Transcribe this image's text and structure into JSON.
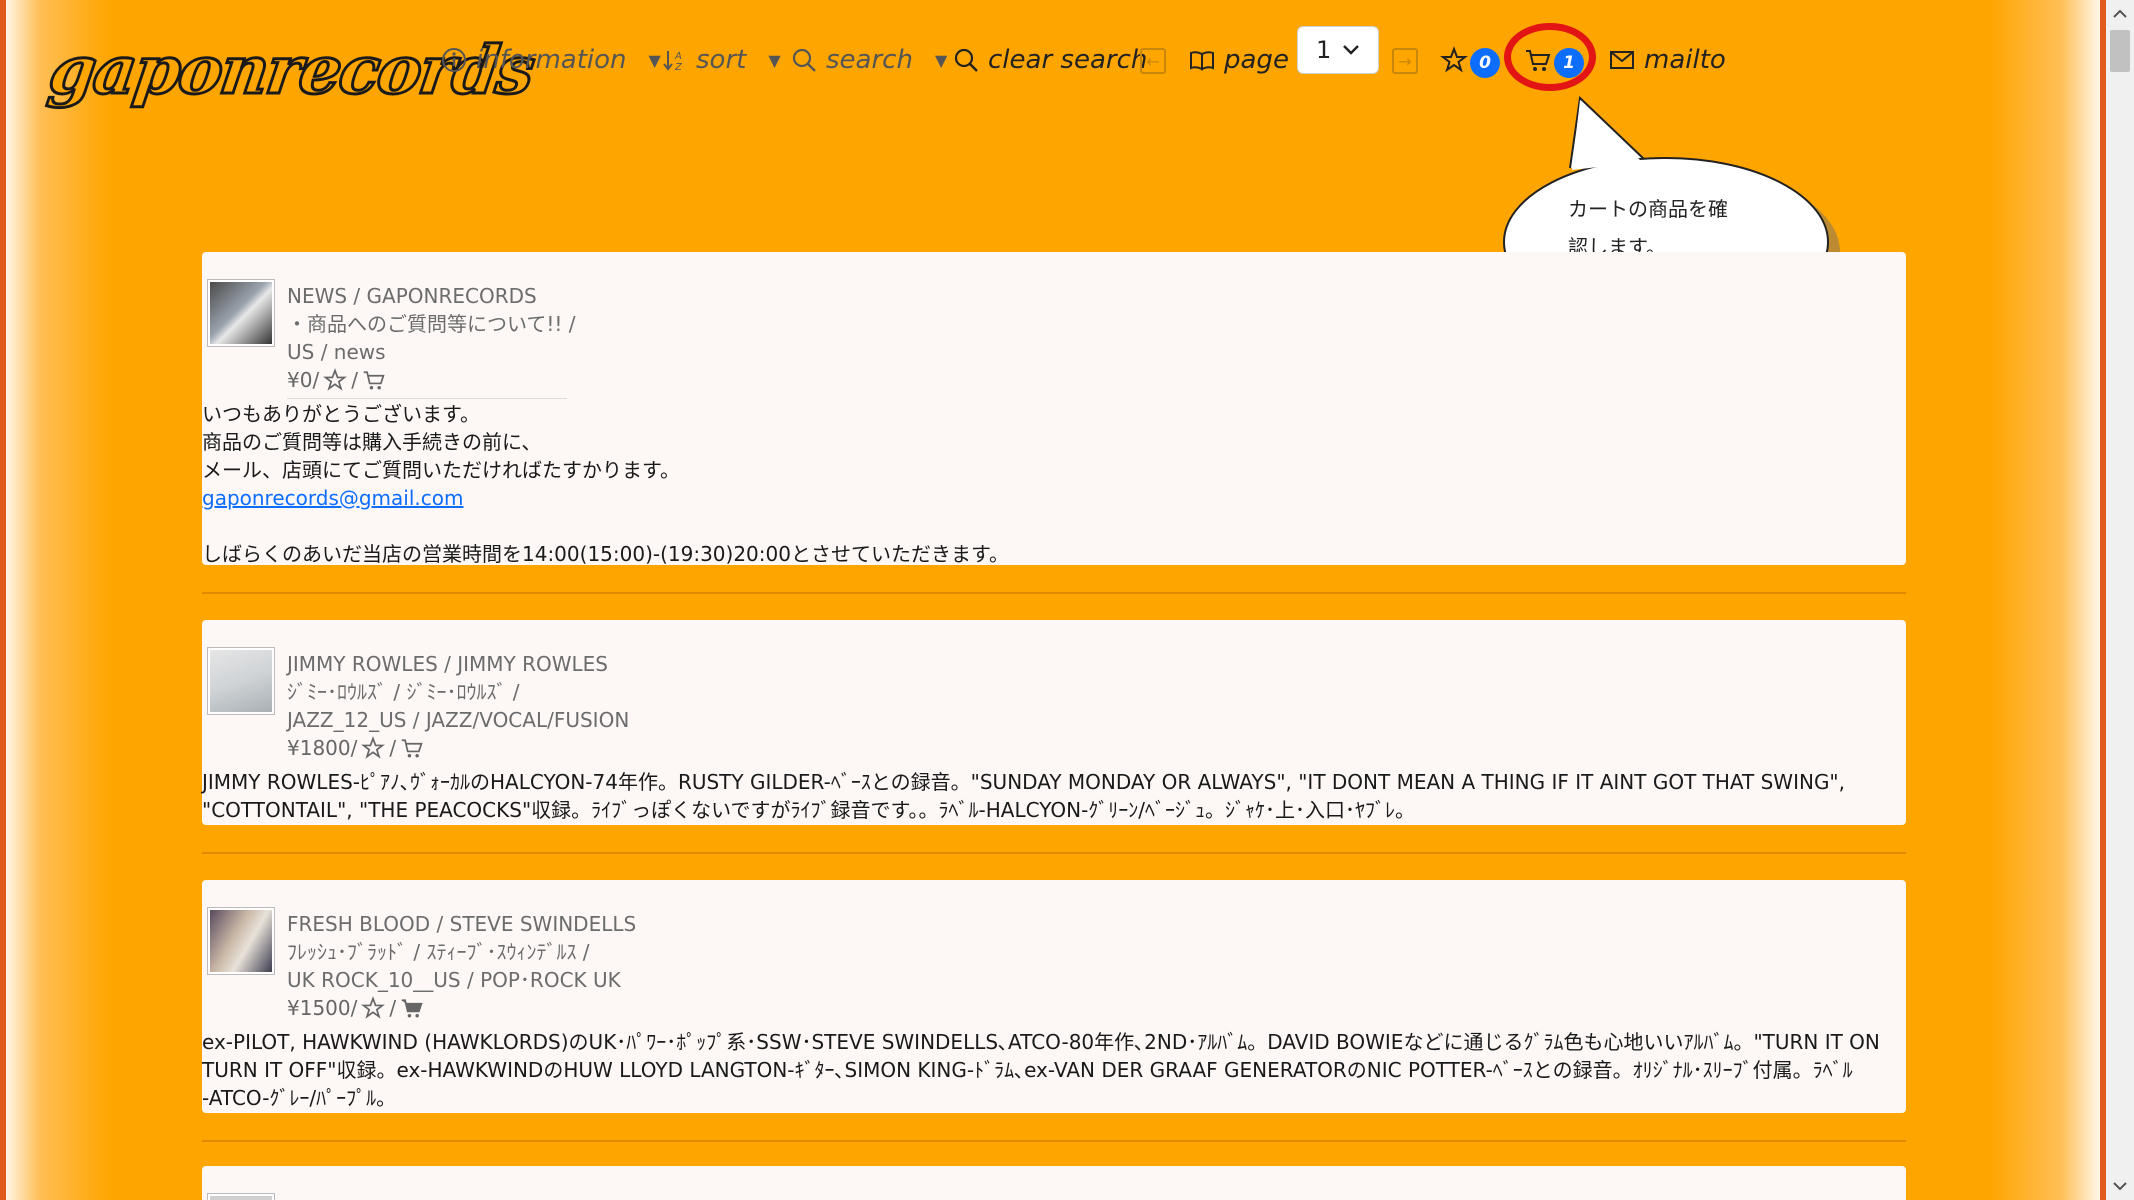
{
  "nav": {
    "logo": "gaponrecords",
    "information": "information",
    "sort": "sort",
    "search": "search",
    "clear_search": "clear search",
    "page": "page",
    "page_value": "1",
    "favorites_count": "0",
    "cart_count": "1",
    "mailto": "mailto"
  },
  "callout": {
    "line1": "カートの商品を確",
    "line2": "認します。"
  },
  "items": [
    {
      "title": "NEWS / GAPONRECORDS",
      "kana": "・商品へのご質問等について!! /",
      "category": "US / news",
      "price": "¥0/",
      "desc_lines": [
        "いつもありがとうございます。",
        "商品のご質問等は購入手続きの前に、",
        "メール、店頭にてご質問いただければたすかります。"
      ],
      "email": "gaponrecords@gmail.com",
      "hours": "しばらくのあいだ当店の営業時間を14:00(15:00)-(19:30)20:00とさせていただきます。"
    },
    {
      "title": "JIMMY ROWLES / JIMMY ROWLES",
      "kana": "ｼﾞﾐｰ･ﾛｳﾙｽﾞ / ｼﾞﾐｰ･ﾛｳﾙｽﾞ /",
      "category": "JAZZ_12_US / JAZZ/VOCAL/FUSION",
      "price": "¥1800/",
      "desc_lines": [
        "JIMMY ROWLES-ﾋﾟｱﾉ､ｳﾞｫｰｶﾙのHALCYON-74年作。RUSTY GILDER-ﾍﾞｰｽとの録音。\"SUNDAY MONDAY OR ALWAYS\", \"IT DONT MEAN A THING IF IT AINT GOT THAT SWING\",",
        "\"COTTONTAIL\", \"THE PEACOCKS\"収録。ﾗｲﾌﾞっぽくないですがﾗｲﾌﾞ録音です。。ﾗﾍﾞﾙ-HALCYON-ｸﾞﾘｰﾝ/ﾍﾞｰｼﾞｭ。ｼﾞｬｹ･上･入口･ﾔﾌﾞﾚ。"
      ]
    },
    {
      "title": "FRESH BLOOD / STEVE SWINDELLS",
      "kana": "ﾌﾚｯｼｭ･ﾌﾞﾗｯﾄﾞ / ｽﾃｨｰﾌﾞ･ｽｳｨﾝﾃﾞﾙｽ /",
      "category": "UK ROCK_10__US / POP･ROCK UK",
      "price": "¥1500/",
      "desc_lines": [
        "ex-PILOT, HAWKWIND (HAWKLORDS)のUK･ﾊﾟﾜｰ･ﾎﾟｯﾌﾟ系･SSW･STEVE SWINDELLS､ATCO-80年作､2ND･ｱﾙﾊﾞﾑ。DAVID BOWIEなどに通じるｸﾞﾗﾑ色も心地いいｱﾙﾊﾞﾑ。\"TURN IT ON",
        "TURN IT OFF\"収録。ex-HAWKWINDのHUW LLOYD LANGTON-ｷﾞﾀｰ､SIMON KING-ﾄﾞﾗﾑ､ex-VAN DER GRAAF GENERATORのNIC POTTER-ﾍﾞｰｽとの録音。ｵﾘｼﾞﾅﾙ･ｽﾘｰﾌﾞ付属。ﾗﾍﾞﾙ",
        "-ATCO-ｸﾞﾚｰ/ﾊﾟｰﾌﾟﾙ。"
      ]
    }
  ],
  "colors": {
    "background": "#ffa500",
    "card": "#fdf7f6",
    "badge": "#0d6efd",
    "highlight": "#e31414",
    "link": "#0d6efd"
  }
}
